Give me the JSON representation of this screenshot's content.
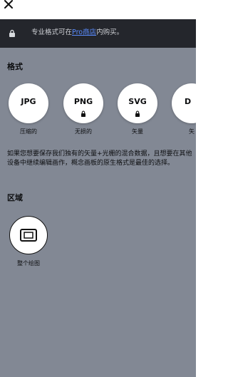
{
  "top": {
    "close_icon": "close-icon"
  },
  "banner": {
    "text_before": "专业格式可在",
    "link": "Pro商店",
    "text_after": "内购买。",
    "icon": "lock-icon"
  },
  "format_section": {
    "title": "格式",
    "items": [
      {
        "name": "JPG",
        "label": "压缩的",
        "locked": false
      },
      {
        "name": "PNG",
        "label": "无损的",
        "locked": true
      },
      {
        "name": "SVG",
        "label": "矢量",
        "locked": true
      },
      {
        "name": "D",
        "label": "矢",
        "locked": false
      }
    ],
    "description": "如果您想要保存我们独有的矢量+光栅的混合数据，且想要在其他设备中继续编辑画作，概念画板的原生格式是最佳的选择。"
  },
  "area_section": {
    "title": "区域",
    "items": [
      {
        "label": "整个绘图",
        "icon": "canvas-frame-icon"
      }
    ]
  }
}
